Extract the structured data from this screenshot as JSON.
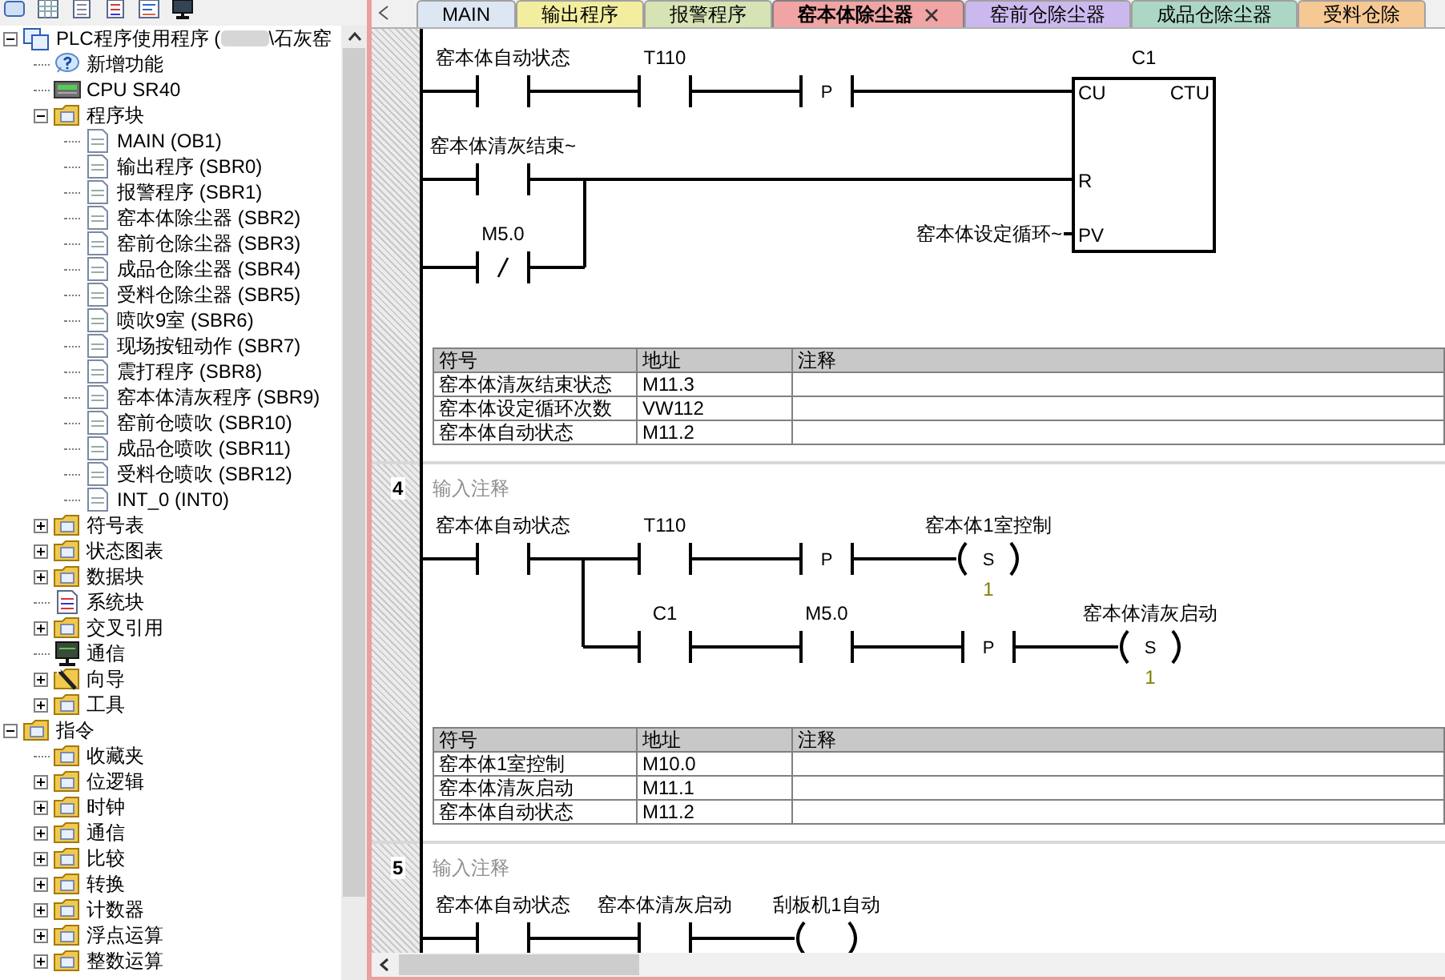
{
  "tree": [
    {
      "kind": "project",
      "label": "PLC程序使用程序 (",
      "label_end": "\\石灰窑",
      "expanded": true,
      "children": [
        {
          "kind": "help",
          "label": "新增功能"
        },
        {
          "kind": "cpu",
          "label": "CPU SR40"
        },
        {
          "kind": "folder",
          "label": "程序块",
          "expanded": true,
          "children": [
            {
              "kind": "page",
              "label": "MAIN (OB1)"
            },
            {
              "kind": "page",
              "label": "输出程序 (SBR0)"
            },
            {
              "kind": "page",
              "label": "报警程序 (SBR1)"
            },
            {
              "kind": "page",
              "label": "窑本体除尘器 (SBR2)"
            },
            {
              "kind": "page",
              "label": "窑前仓除尘器 (SBR3)"
            },
            {
              "kind": "page",
              "label": "成品仓除尘器 (SBR4)"
            },
            {
              "kind": "page",
              "label": "受料仓除尘器 (SBR5)"
            },
            {
              "kind": "page",
              "label": "喷吹9室 (SBR6)"
            },
            {
              "kind": "page",
              "label": "现场按钮动作 (SBR7)"
            },
            {
              "kind": "page",
              "label": "震打程序 (SBR8)"
            },
            {
              "kind": "page",
              "label": "窑本体清灰程序 (SBR9)"
            },
            {
              "kind": "page",
              "label": "窑前仓喷吹 (SBR10)"
            },
            {
              "kind": "page",
              "label": "成品仓喷吹 (SBR11)"
            },
            {
              "kind": "page",
              "label": "受料仓喷吹 (SBR12)"
            },
            {
              "kind": "page",
              "label": "INT_0 (INT0)"
            }
          ]
        },
        {
          "kind": "folder",
          "label": "符号表",
          "expanded": false
        },
        {
          "kind": "folder",
          "label": "状态图表",
          "expanded": false
        },
        {
          "kind": "folder",
          "label": "数据块",
          "expanded": false
        },
        {
          "kind": "doc",
          "label": "系统块"
        },
        {
          "kind": "folder",
          "label": "交叉引用",
          "expanded": false
        },
        {
          "kind": "monitor",
          "label": "通信"
        },
        {
          "kind": "wand",
          "label": "向导",
          "expanded": false
        },
        {
          "kind": "folder",
          "label": "工具",
          "expanded": false
        }
      ]
    },
    {
      "kind": "folder",
      "label": "指令",
      "expanded": true,
      "children": [
        {
          "kind": "folder",
          "label": "收藏夹"
        },
        {
          "kind": "folder",
          "label": "位逻辑",
          "expanded": false
        },
        {
          "kind": "folder",
          "label": "时钟",
          "expanded": false
        },
        {
          "kind": "folder",
          "label": "通信",
          "expanded": false
        },
        {
          "kind": "folder",
          "label": "比较",
          "expanded": false
        },
        {
          "kind": "folder",
          "label": "转换",
          "expanded": false
        },
        {
          "kind": "folder",
          "label": "计数器",
          "expanded": false
        },
        {
          "kind": "folder",
          "label": "浮点运算",
          "expanded": false
        },
        {
          "kind": "folder",
          "label": "整数运算",
          "expanded": false
        }
      ]
    }
  ],
  "tabs": [
    {
      "label": "MAIN",
      "color": "#dde6f3",
      "selected": false
    },
    {
      "label": "输出程序",
      "color": "#f3eda0",
      "selected": false
    },
    {
      "label": "报警程序",
      "color": "#d6e3b4",
      "selected": false
    },
    {
      "label": "窑本体除尘器",
      "color": "#f0a4a4",
      "selected": true
    },
    {
      "label": "窑前仓除尘器",
      "color": "#cbb9ee",
      "selected": false
    },
    {
      "label": "成品仓除尘器",
      "color": "#acd7c4",
      "selected": false
    },
    {
      "label": "受料仓除",
      "color": "#f6c894",
      "selected": false
    }
  ],
  "networks": [
    {
      "rows": [
        {
          "kind": "rail",
          "elements": [
            {
              "kind": "contact",
              "label": "窑本体自动状态"
            },
            {
              "kind": "contact",
              "label": "T110"
            },
            {
              "kind": "edge",
              "text": "P"
            }
          ]
        },
        {
          "kind": "rail",
          "elements": [
            {
              "kind": "contact",
              "label": "窑本体清灰结束~"
            }
          ]
        },
        {
          "kind": "join",
          "elements": [
            {
              "kind": "nc_contact",
              "label": "M5.0"
            }
          ]
        }
      ],
      "box": {
        "name": "C1",
        "type": "CTU",
        "pins": [
          {
            "label": "CU"
          },
          {
            "label": "R"
          },
          {
            "label": "PV",
            "input": "窑本体设定循环~"
          }
        ]
      },
      "symbol_table": {
        "columns": [
          "符号",
          "地址",
          "注释"
        ],
        "rows": [
          [
            "窑本体清灰结束状态",
            "M11.3"
          ],
          [
            "窑本体设定循环次数",
            "VW112"
          ],
          [
            "窑本体自动状态",
            "M11.2"
          ]
        ]
      }
    },
    {
      "number": "4",
      "comment": "输入注释",
      "rows": [
        {
          "kind": "rail",
          "elements": [
            {
              "kind": "contact",
              "label": "窑本体自动状态"
            },
            {
              "kind": "contact",
              "label": "T110"
            },
            {
              "kind": "edge",
              "text": "P"
            },
            {
              "kind": "set_coil",
              "label": "窑本体1室控制",
              "text": "S",
              "count": "1"
            }
          ]
        },
        {
          "kind": "branch",
          "elements": [
            {
              "kind": "contact",
              "label": "C1"
            },
            {
              "kind": "contact",
              "label": "M5.0"
            },
            {
              "kind": "edge",
              "text": "P"
            },
            {
              "kind": "set_coil",
              "label": "窑本体清灰启动",
              "text": "S",
              "count": "1"
            }
          ]
        }
      ],
      "symbol_table": {
        "columns": [
          "符号",
          "地址",
          "注释"
        ],
        "rows": [
          [
            "窑本体1室控制",
            "M10.0"
          ],
          [
            "窑本体清灰启动",
            "M11.1"
          ],
          [
            "窑本体自动状态",
            "M11.2"
          ]
        ]
      }
    },
    {
      "number": "5",
      "comment": "输入注释",
      "rows": [
        {
          "kind": "rail",
          "elements": [
            {
              "kind": "contact",
              "label": "窑本体自动状态"
            },
            {
              "kind": "contact",
              "label": "窑本体清灰启动"
            },
            {
              "kind": "coil",
              "label": "刮板机1自动"
            }
          ]
        }
      ]
    }
  ]
}
